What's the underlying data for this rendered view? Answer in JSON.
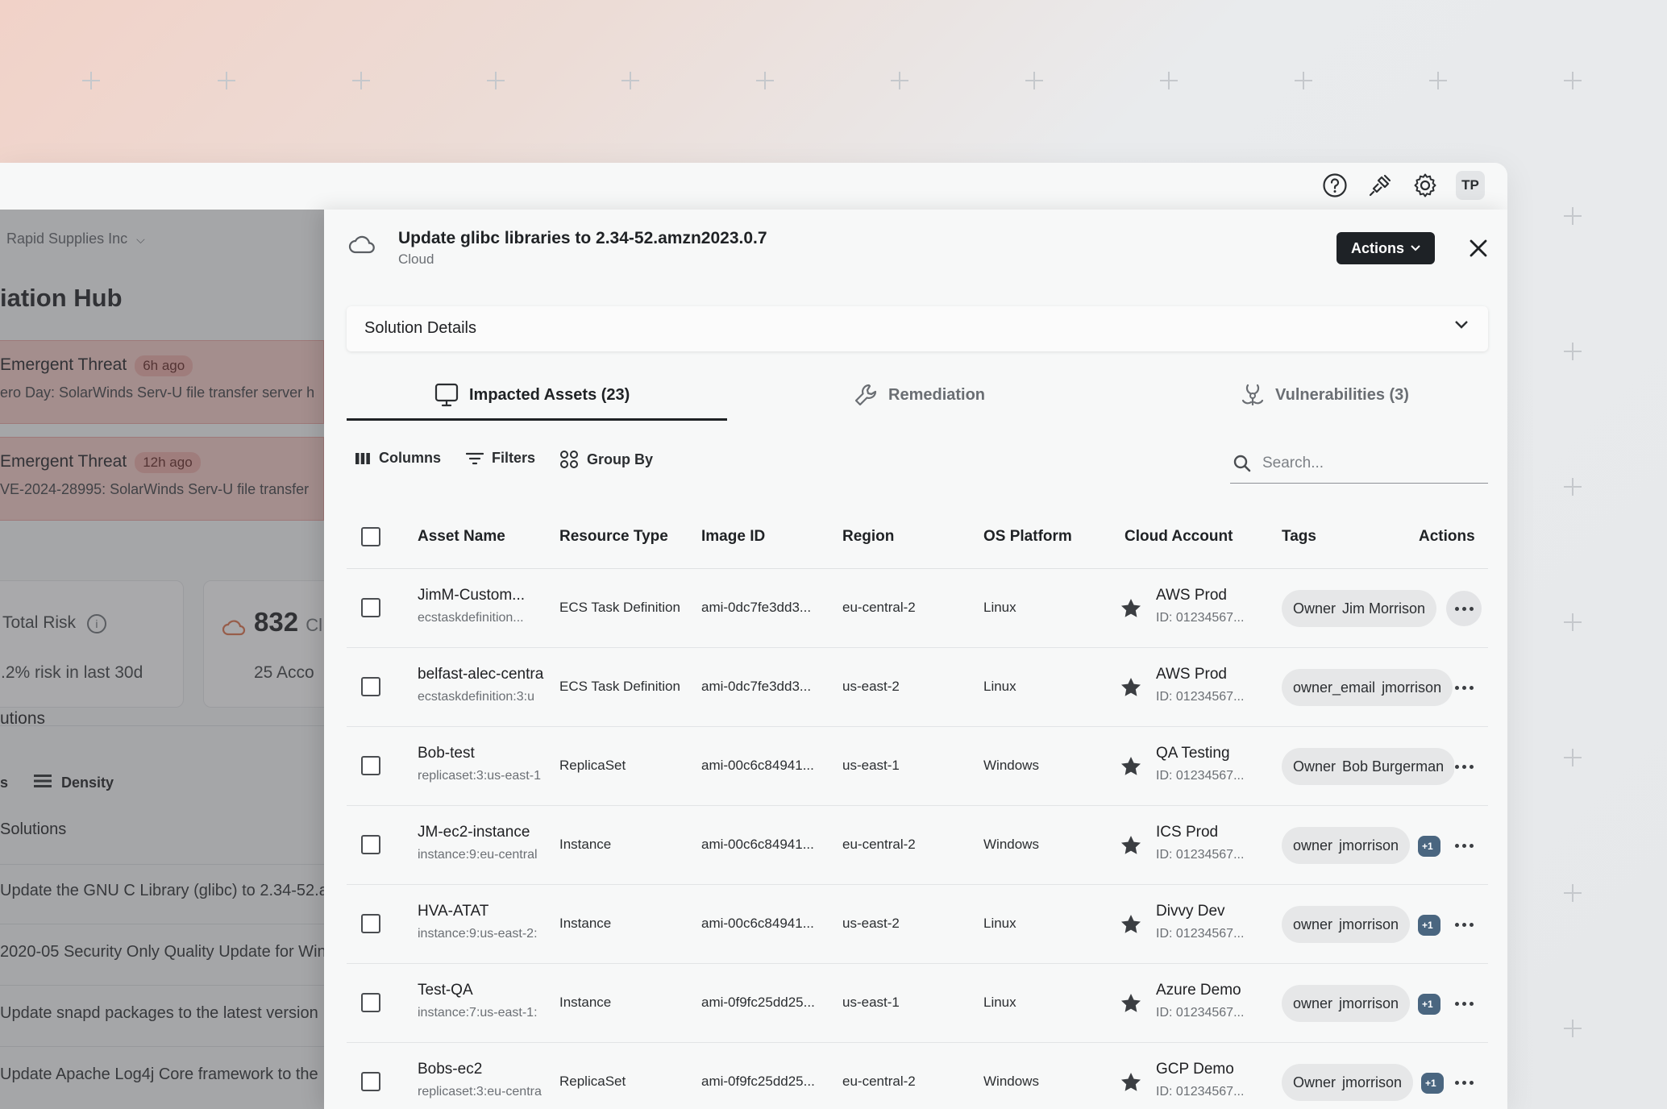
{
  "topbar": {
    "help_icon": "help-circle-icon",
    "integrations_icon": "plug-icon",
    "settings_icon": "gear-icon",
    "avatar_initials": "TP"
  },
  "background_page": {
    "org_name": "Rapid Supplies Inc",
    "title": "iation Hub",
    "alerts": [
      {
        "title": "Emergent Threat",
        "age": "6h ago",
        "description": "ero Day: SolarWinds Serv-U file transfer server h"
      },
      {
        "title": "Emergent Threat",
        "age": "12h ago",
        "description": "VE-2024-28995: SolarWinds Serv-U file transfer"
      }
    ],
    "total_risk_label": "Total Risk",
    "total_risk_sub": ".2% risk in last 30d",
    "cloud_accounts_value": "832",
    "cloud_accounts_label_fragment": "Cl",
    "cloud_accounts_sub": "25 Acco",
    "section_title": "utions",
    "density_prefix": "s",
    "density_label": "Density",
    "solutions_header": "Solutions",
    "solutions": [
      "Update the GNU C Library (glibc) to 2.34-52.a",
      "2020-05 Security Only Quality Update for Win",
      "Update snapd packages to the latest version",
      "Update Apache Log4j Core framework to the"
    ]
  },
  "drawer": {
    "title": "Update glibc libraries to 2.34-52.amzn2023.0.7",
    "subtitle": "Cloud",
    "actions_label": "Actions",
    "solution_details_label": "Solution Details",
    "tabs": [
      {
        "label": "Impacted Assets (23)",
        "icon": "monitor-icon",
        "active": true
      },
      {
        "label": "Remediation",
        "icon": "wrench-icon",
        "active": false
      },
      {
        "label": "Vulnerabilities (3)",
        "icon": "biohazard-icon",
        "active": false
      }
    ],
    "toolbar": {
      "columns_label": "Columns",
      "filters_label": "Filters",
      "group_by_label": "Group By",
      "search_placeholder": "Search..."
    },
    "table": {
      "headers": [
        "Asset Name",
        "Resource Type",
        "Image ID",
        "Region",
        "OS Platform",
        "Cloud Account",
        "Tags",
        "Actions"
      ],
      "rows": [
        {
          "name": "JimM-Custom...",
          "id": "ecstaskdefinition...",
          "resource_type": "ECS Task Definition",
          "image_id": "ami-0dc7fe3dd3...",
          "region": "eu-central-2",
          "os": "Linux",
          "account": "AWS Prod",
          "account_id": "ID: 01234567...",
          "tag_key": "Owner",
          "tag_value": "Jim Morrison",
          "extra_tags": "",
          "hover": true
        },
        {
          "name": "belfast-alec-centra",
          "id": "ecstaskdefinition:3:u",
          "resource_type": "ECS Task Definition",
          "image_id": "ami-0dc7fe3dd3...",
          "region": "us-east-2",
          "os": "Linux",
          "account": "AWS Prod",
          "account_id": "ID: 01234567...",
          "tag_key": "owner_email",
          "tag_value": "jmorrison",
          "extra_tags": "",
          "hover": false
        },
        {
          "name": "Bob-test",
          "id": "replicaset:3:us-east-1",
          "resource_type": "ReplicaSet",
          "image_id": "ami-00c6c84941...",
          "region": "us-east-1",
          "os": "Windows",
          "account": "QA Testing",
          "account_id": "ID: 01234567...",
          "tag_key": "Owner",
          "tag_value": "Bob Burgerman",
          "extra_tags": "",
          "hover": false
        },
        {
          "name": "JM-ec2-instance",
          "id": "instance:9:eu-central",
          "resource_type": "Instance",
          "image_id": "ami-00c6c84941...",
          "region": "eu-central-2",
          "os": "Windows",
          "account": "ICS Prod",
          "account_id": "ID: 01234567...",
          "tag_key": "owner",
          "tag_value": "jmorrison",
          "extra_tags": "+1",
          "hover": false
        },
        {
          "name": "HVA-ATAT",
          "id": "instance:9:us-east-2:",
          "resource_type": "Instance",
          "image_id": "ami-00c6c84941...",
          "region": "us-east-2",
          "os": "Linux",
          "account": "Divvy Dev",
          "account_id": "ID: 01234567...",
          "tag_key": "owner",
          "tag_value": "jmorrison",
          "extra_tags": "+1",
          "hover": false
        },
        {
          "name": "Test-QA",
          "id": "instance:7:us-east-1:",
          "resource_type": "Instance",
          "image_id": "ami-0f9fc25dd25...",
          "region": "us-east-1",
          "os": "Linux",
          "account": "Azure Demo",
          "account_id": "ID: 01234567...",
          "tag_key": "owner",
          "tag_value": "jmorrison",
          "extra_tags": "+1",
          "hover": false
        },
        {
          "name": "Bobs-ec2",
          "id": "replicaset:3:eu-centra",
          "resource_type": "ReplicaSet",
          "image_id": "ami-0f9fc25dd25...",
          "region": "eu-central-2",
          "os": "Windows",
          "account": "GCP Demo",
          "account_id": "ID: 01234567...",
          "tag_key": "Owner",
          "tag_value": "jmorrison",
          "extra_tags": "+1",
          "hover": false
        }
      ]
    }
  },
  "colors": {
    "primary_dark": "#1e2226",
    "alert_bg": "#f1c8c4",
    "tag_more": "#4a6680"
  }
}
